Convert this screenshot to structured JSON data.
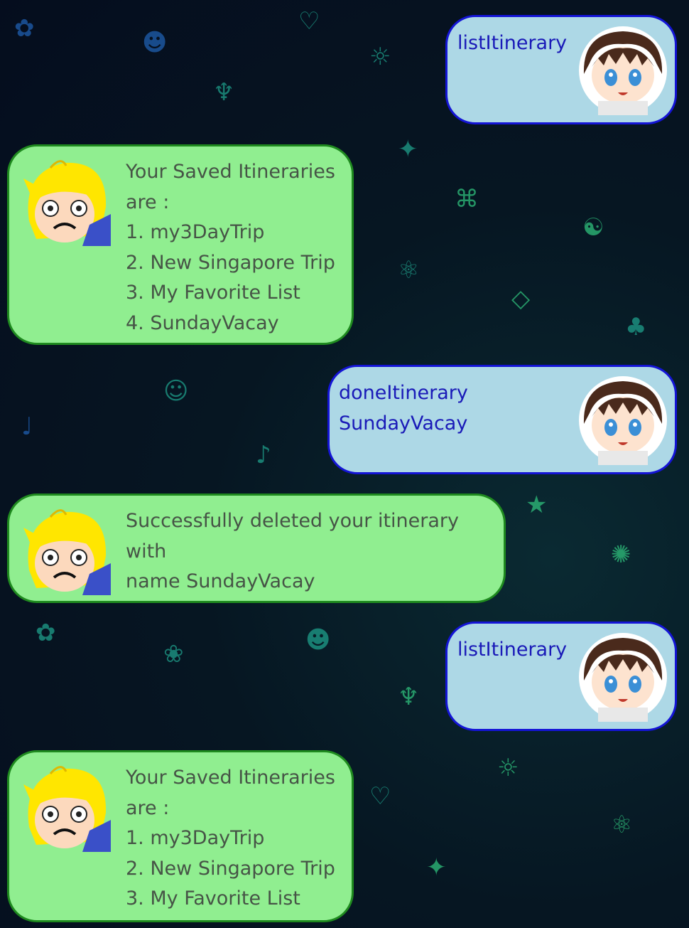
{
  "chat": {
    "messages": [
      {
        "sender": "user",
        "text": "listItinerary"
      },
      {
        "sender": "bot",
        "text": "Your Saved Itineraries\nare :\n1. my3DayTrip\n2. New Singapore Trip\n3. My Favorite List\n4. SundayVacay"
      },
      {
        "sender": "user",
        "text": "doneItinerary\nSundayVacay"
      },
      {
        "sender": "bot",
        "text": "Successfully deleted your itinerary with\nname SundayVacay"
      },
      {
        "sender": "user",
        "text": "listItinerary"
      },
      {
        "sender": "bot",
        "text": "Your Saved Itineraries\nare :\n1. my3DayTrip\n2. New Singapore Trip\n3. My Favorite List"
      }
    ],
    "avatars": {
      "user": "user-avatar",
      "bot": "bot-avatar"
    },
    "colors": {
      "user_bubble": "#add8e6",
      "user_border": "#1414d6",
      "bot_bubble": "#90ee90",
      "bot_border": "#1f8a1f"
    }
  }
}
